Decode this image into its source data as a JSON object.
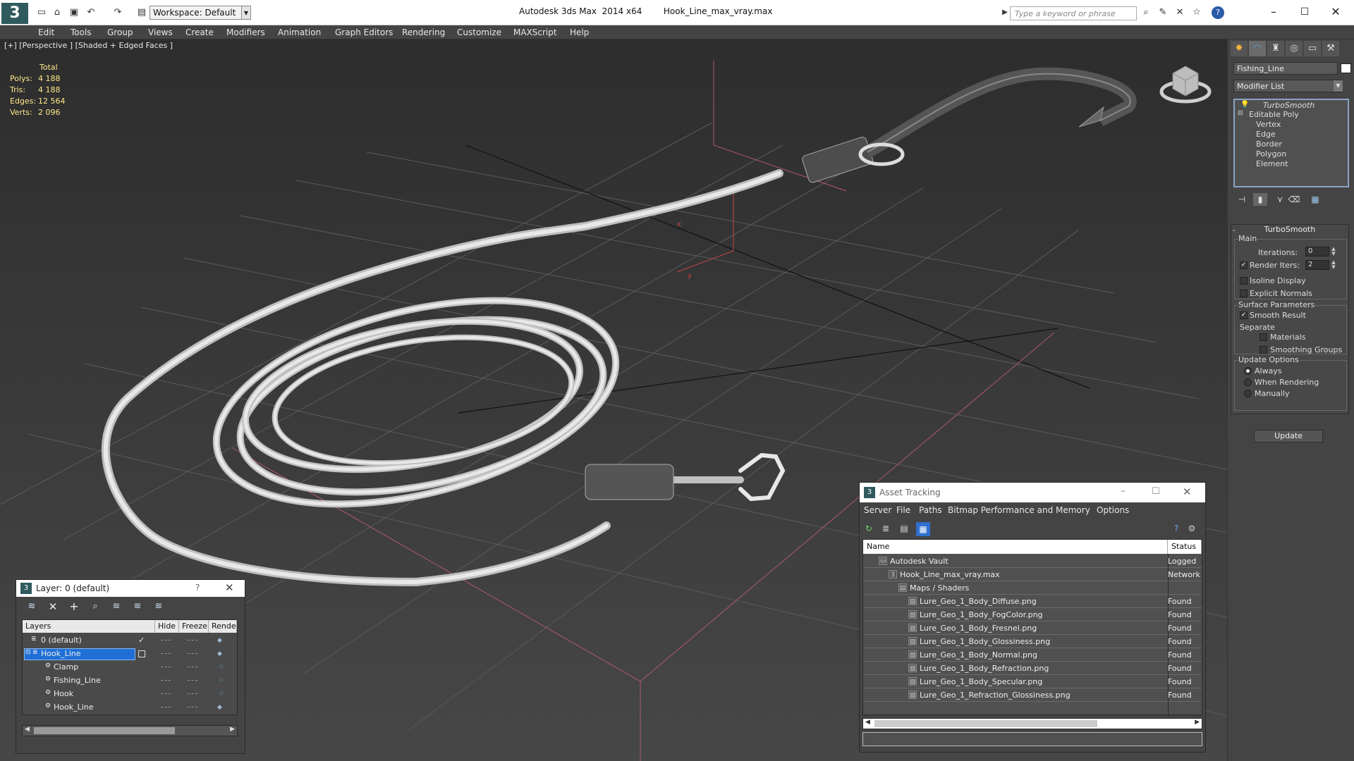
{
  "title_bar": {
    "app_title": "Autodesk 3ds Max  2014 x64",
    "file_name": "Hook_Line_max_vray.max",
    "workspace": "Workspace: Default",
    "search_placeholder": "Type a keyword or phrase",
    "logo": "3",
    "icons": [
      "new-file-icon",
      "open-icon",
      "save-icon",
      "undo-icon",
      "redo-icon",
      "project-icon"
    ]
  },
  "menu": [
    "Edit",
    "Tools",
    "Group",
    "Views",
    "Create",
    "Modifiers",
    "Animation",
    "Graph Editors",
    "Rendering",
    "Customize",
    "MAXScript",
    "Help"
  ],
  "viewport": {
    "label": "[+] [Perspective ] [Shaded + Edged Faces ]",
    "stats": {
      "header": "Total",
      "rows": [
        {
          "label": "Polys:",
          "value": "4 188"
        },
        {
          "label": "Tris:",
          "value": "4 188"
        },
        {
          "label": "Edges:",
          "value": "12 564"
        },
        {
          "label": "Verts:",
          "value": "2 096"
        }
      ]
    },
    "axis_labels": {
      "x": "x",
      "y": "y"
    }
  },
  "command_panel": {
    "object_name": "Fishing_Line",
    "modifier_list": "Modifier List",
    "stack": {
      "top": "TurboSmooth",
      "base": "Editable Poly",
      "subobjects": [
        "Vertex",
        "Edge",
        "Border",
        "Polygon",
        "Element"
      ]
    },
    "turbosmooth": {
      "title": "TurboSmooth",
      "main_label": "Main",
      "iterations_label": "Iterations:",
      "iterations_value": "0",
      "render_iters_label": "Render Iters:",
      "render_iters_value": "2",
      "render_iters_checked": true,
      "isoline_label": "Isoline Display",
      "explicit_label": "Explicit Normals",
      "surface_label": "Surface Parameters",
      "smooth_result_label": "Smooth Result",
      "separate_label": "Separate",
      "materials_label": "Materials",
      "smoothing_groups_label": "Smoothing Groups",
      "update_options_label": "Update Options",
      "always_label": "Always",
      "when_rendering_label": "When Rendering",
      "manually_label": "Manually",
      "update_button": "Update"
    }
  },
  "layer_window": {
    "title": "Layer: 0 (default)",
    "help": "?",
    "columns": [
      "Layers",
      "Hide",
      "Freeze",
      "Render"
    ],
    "rows": [
      {
        "name": "0 (default)",
        "indent": 0,
        "selected": false
      },
      {
        "name": "Hook_Line",
        "indent": 0,
        "selected": true
      },
      {
        "name": "Clamp",
        "indent": 1,
        "selected": false
      },
      {
        "name": "Fishing_Line",
        "indent": 1,
        "selected": false
      },
      {
        "name": "Hook",
        "indent": 1,
        "selected": false
      },
      {
        "name": "Hook_Line",
        "indent": 1,
        "selected": false
      }
    ]
  },
  "asset_window": {
    "title": "Asset Tracking",
    "menu": [
      "Server",
      "File",
      "Paths",
      "Bitmap Performance and Memory",
      "Options"
    ],
    "columns": [
      "Name",
      "Status"
    ],
    "rows": [
      {
        "name": "Autodesk Vault",
        "status": "Logged",
        "indent": 0
      },
      {
        "name": "Hook_Line_max_vray.max",
        "status": "Network",
        "indent": 1
      },
      {
        "name": "Maps / Shaders",
        "status": "",
        "indent": 2
      },
      {
        "name": "Lure_Geo_1_Body_Diffuse.png",
        "status": "Found",
        "indent": 3
      },
      {
        "name": "Lure_Geo_1_Body_FogColor.png",
        "status": "Found",
        "indent": 3
      },
      {
        "name": "Lure_Geo_1_Body_Fresnel.png",
        "status": "Found",
        "indent": 3
      },
      {
        "name": "Lure_Geo_1_Body_Glossiness.png",
        "status": "Found",
        "indent": 3
      },
      {
        "name": "Lure_Geo_1_Body_Normal.png",
        "status": "Found",
        "indent": 3
      },
      {
        "name": "Lure_Geo_1_Body_Refraction.png",
        "status": "Found",
        "indent": 3
      },
      {
        "name": "Lure_Geo_1_Body_Specular.png",
        "status": "Found",
        "indent": 3
      },
      {
        "name": "Lure_Geo_1_Refraction_Glossiness.png",
        "status": "Found",
        "indent": 3
      }
    ]
  }
}
